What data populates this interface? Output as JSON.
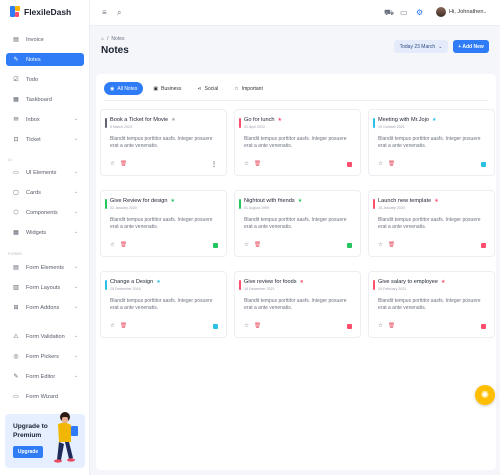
{
  "app": {
    "name": "FlexileDash"
  },
  "sidebar": {
    "items": [
      {
        "label": "Invoice",
        "icon": "document-icon",
        "symbol": "▤"
      },
      {
        "label": "Notes",
        "icon": "notes-icon",
        "symbol": "✎"
      },
      {
        "label": "Todo",
        "icon": "todo-icon",
        "symbol": "☑"
      },
      {
        "label": "Taskboard",
        "icon": "taskboard-icon",
        "symbol": "▦"
      },
      {
        "label": "Inbox",
        "icon": "inbox-icon",
        "symbol": "✉"
      },
      {
        "label": "Ticket",
        "icon": "ticket-icon",
        "symbol": "⊡"
      },
      {
        "label": "UI Elements",
        "icon": "ui-elements-icon",
        "symbol": "▭"
      },
      {
        "label": "Cards",
        "icon": "cards-icon",
        "symbol": "▢"
      },
      {
        "label": "Components",
        "icon": "components-icon",
        "symbol": "⬡"
      },
      {
        "label": "Widgets",
        "icon": "widgets-icon",
        "symbol": "▦"
      },
      {
        "label": "Form Elements",
        "icon": "form-elements-icon",
        "symbol": "▤"
      },
      {
        "label": "Form Layouts",
        "icon": "form-layouts-icon",
        "symbol": "▥"
      },
      {
        "label": "Form Addons",
        "icon": "form-addons-icon",
        "symbol": "⊞"
      },
      {
        "label": "Form Validation",
        "icon": "form-validation-icon",
        "symbol": "⚠"
      },
      {
        "label": "Form Pickers",
        "icon": "form-pickers-icon",
        "symbol": "◎"
      },
      {
        "label": "Form Editor",
        "icon": "form-editor-icon",
        "symbol": "✎"
      },
      {
        "label": "Form Wizard",
        "icon": "form-wizard-icon",
        "symbol": "▭"
      }
    ],
    "sections": [
      "UI",
      "FORMS"
    ],
    "upgrade": {
      "title": "Upgrade to Premium",
      "button": "Upgrade"
    }
  },
  "topbar": {
    "user_name": "Hi, Johnathen"
  },
  "breadcrumb": {
    "current": "Notes"
  },
  "page_title": "Notes",
  "date_pill": "Today 23 March",
  "add_button": "+ Add New",
  "tabs": [
    {
      "label": "All Notes",
      "icon": "all-notes-icon",
      "symbol": "◉"
    },
    {
      "label": "Business",
      "icon": "business-icon",
      "symbol": "▣"
    },
    {
      "label": "Social",
      "icon": "social-icon",
      "symbol": "⋖"
    },
    {
      "label": "Important",
      "icon": "star-icon",
      "symbol": "☆"
    }
  ],
  "notes": [
    {
      "title": "Book a Ticket for Movie",
      "date": "9 March 2023",
      "body": "Blandit tempus porttitor aasfs. Integer posuere erat a ante venenatis.",
      "bar": "#5f6470",
      "star": "#9aa0ab",
      "tag": "more"
    },
    {
      "title": "Go for lunch",
      "date": "01 April 2022",
      "body": "Blandit tempus porttitor aasfs. Integer posuere erat a ante venenatis.",
      "bar": "#ff4d6d",
      "star": "#ff4d6d",
      "tag": "#ff4d6d"
    },
    {
      "title": "Meeting with Mr.Jojo",
      "date": "19 October 2021",
      "body": "Blandit tempus porttitor aasfs. Integer posuere erat a ante venenatis.",
      "bar": "#2bc0e4",
      "star": "#2bc0e4",
      "tag": "#2bc0e4"
    },
    {
      "title": "Give Review for design",
      "date": "02 January 2020",
      "body": "Blandit tempus porttitor aasfs. Integer posuere erat a ante venenatis.",
      "bar": "#22c55e",
      "star": "#22c55e",
      "tag": "#22c55e"
    },
    {
      "title": "Nightout with friends",
      "date": "01 August 1999",
      "body": "Blandit tempus porttitor aasfs. Integer posuere erat a ante venenatis.",
      "bar": "#22c55e",
      "star": "#22c55e",
      "tag": "#22c55e"
    },
    {
      "title": "Launch new template",
      "date": "15 January 2020",
      "body": "Blandit tempus porttitor aasfs. Integer posuere erat a ante venenatis.",
      "bar": "#ff4d6d",
      "star": "#ff4d6d",
      "tag": "#ff4d6d"
    },
    {
      "title": "Change a Design",
      "date": "25 December 2016",
      "body": "Blandit tempus porttitor aasfs. Integer posuere erat a ante venenatis.",
      "bar": "#2bc0e4",
      "star": "#2bc0e4",
      "tag": "#2bc0e4"
    },
    {
      "title": "Give review for foods",
      "date": "18 December 2021",
      "body": "Blandit tempus porttitor aasfs. Integer posuere erat a ante venenatis.",
      "bar": "#ff4d6d",
      "star": "#ff4d6d",
      "tag": "#ff4d6d"
    },
    {
      "title": "Give salary to employee",
      "date": "15 February 2021",
      "body": "Blandit tempus porttitor aasfs. Integer posuere erat a ante venenatis.",
      "bar": "#ff4d6d",
      "star": "#ff4d6d",
      "tag": "#ff4d6d"
    }
  ],
  "fab": {
    "icon": "settings-gear-icon"
  }
}
